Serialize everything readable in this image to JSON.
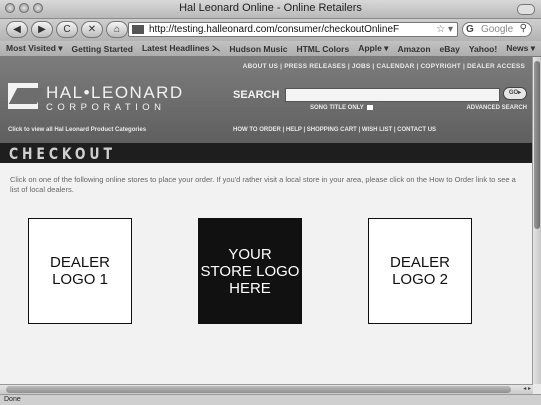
{
  "window": {
    "title": "Hal Leonard Online - Online Retailers"
  },
  "toolbar": {
    "back_label": "◀",
    "forward_label": "▶",
    "reload_label": "C",
    "stop_label": "✕",
    "home_label": "⌂",
    "url": "http://testing.halleonard.com/consumer/checkoutOnlineF",
    "search_placeholder": "Google",
    "search_engine_label": "G"
  },
  "bookmarks": [
    "Most Visited ▾",
    "Getting Started",
    "Latest Headlines ⋋",
    "Hudson Music",
    "HTML Colors",
    "Apple ▾",
    "Amazon",
    "eBay",
    "Yahoo!",
    "News ▾"
  ],
  "header": {
    "top_links": "ABOUT US  |  PRESS RELEASES  |  JOBS  |  CALENDAR  |  COPYRIGHT  |  DEALER ACCESS",
    "logo_name": "HAL•LEONARD",
    "logo_sub": "CORPORATION",
    "search_label": "SEARCH",
    "go_label": "GO▸",
    "song_title_only": "SONG TITLE ONLY",
    "advanced_search": "ADVANCED SEARCH",
    "categories_link": "Click to view all Hal Leonard Product Categories",
    "nav_links": "HOW TO ORDER  |  HELP  |  SHOPPING CART  |  WISH LIST  |  CONTACT US"
  },
  "checkout": {
    "heading": "CHECKOUT",
    "intro": "Click on one of the following online stores to place your order. If you'd rather visit a local store in your area, please click on the How to Order link to see a list of local dealers."
  },
  "logos": [
    {
      "label": "DEALER\nLOGO 1"
    },
    {
      "label": "YOUR\nSTORE LOGO\nHERE"
    },
    {
      "label": "DEALER\nLOGO 2"
    }
  ],
  "status": {
    "text": "Done"
  }
}
